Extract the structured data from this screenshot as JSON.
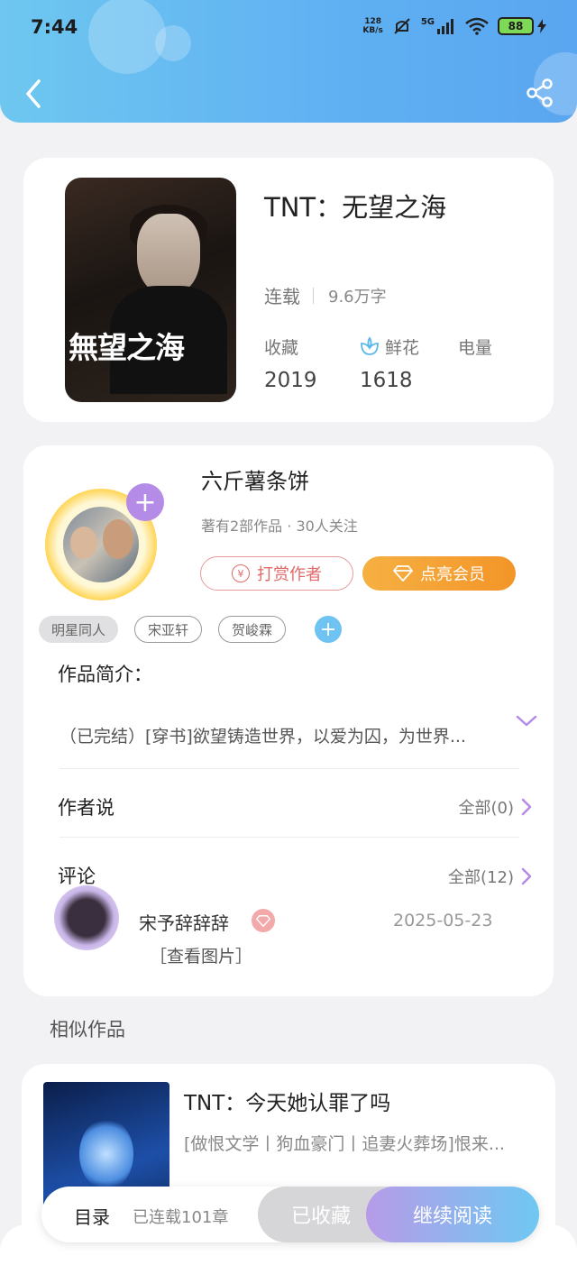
{
  "status_bar": {
    "time": "7:44",
    "net_speed_value": "128",
    "net_speed_unit": "KB/s",
    "signal": "5G",
    "battery": "88"
  },
  "book": {
    "title": "TNT：无望之海",
    "cover_title": "無望之海",
    "serial_status": "连载",
    "word_count": "9.6万字",
    "stats": [
      {
        "label": "收藏",
        "value": "2019"
      },
      {
        "label": "鲜花",
        "value": "1618"
      },
      {
        "label": "电量",
        "value": ""
      }
    ]
  },
  "author": {
    "name": "六斤薯条饼",
    "meta": "著有2部作品 · 30人关注",
    "tip_label": "打赏作者",
    "vip_label": "点亮会员",
    "tags": [
      "明星同人",
      "宋亚轩",
      "贺峻霖"
    ]
  },
  "intro": {
    "heading": "作品简介：",
    "text": "（已完结）[穿书]欲望铸造世界，以爱为囚，为世界..."
  },
  "author_says": {
    "heading": "作者说",
    "link": "全部(0)"
  },
  "comments": {
    "heading": "评论",
    "link": "全部(12)",
    "items": [
      {
        "user": "宋予辞辞辞",
        "date": "2025-05-23",
        "text": "［查看图片］"
      }
    ]
  },
  "similar": {
    "heading": "相似作品",
    "items": [
      {
        "title": "TNT：今天她认罪了吗",
        "desc": "[做恨文学丨狗血豪门丨追妻火葬场]恨来..."
      }
    ]
  },
  "bottom_bar": {
    "toc_label": "目录",
    "chapter_count": "已连载101章",
    "favorited_label": "已收藏",
    "continue_label": "继续阅读"
  },
  "colors": {
    "header": "#5fb0f2",
    "vip": "#f39528",
    "tip": "#e06a6a",
    "accent_purple": "#b48be6"
  }
}
